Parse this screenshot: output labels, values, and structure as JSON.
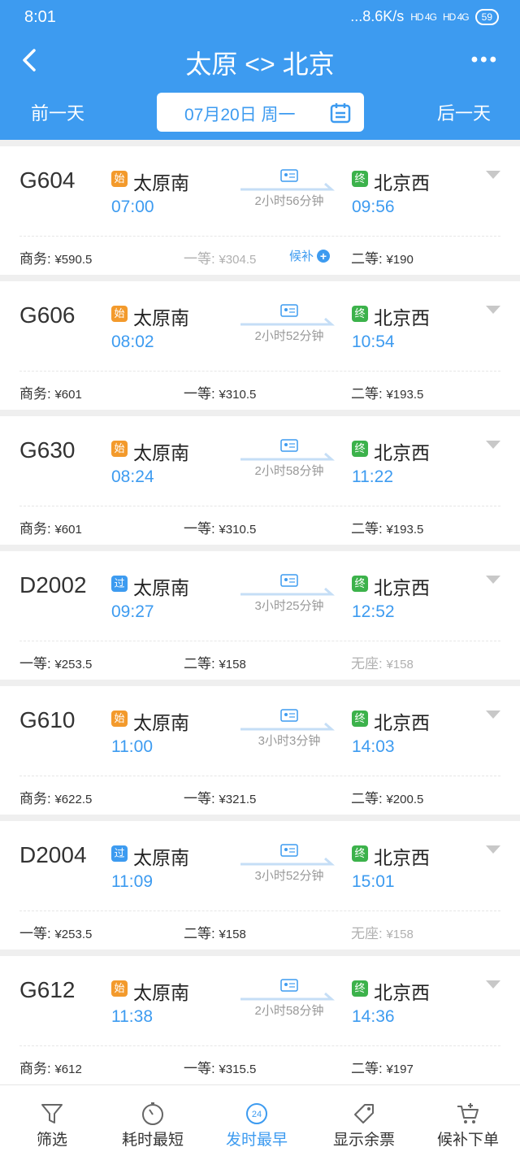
{
  "status_bar": {
    "time": "8:01",
    "net_speed": "...8.6K/s",
    "signal1": "HD 4G",
    "signal2": "HD 4G",
    "battery": "59"
  },
  "header": {
    "title": "太原 <> 北京",
    "prev_day": "前一天",
    "next_day": "后一天",
    "date": "07月20日 周一"
  },
  "trains": [
    {
      "no": "G604",
      "from_tag": "始",
      "from": "太原南",
      "dep": "07:00",
      "duration": "2小时56分钟",
      "to_tag": "终",
      "to": "北京西",
      "arr": "09:56",
      "p1_label": "商务:",
      "p1": "¥590.5",
      "p2_label": "一等:",
      "p2": "¥304.5",
      "houbu": "候补",
      "p3_label": "二等:",
      "p3": "¥190"
    },
    {
      "no": "G606",
      "from_tag": "始",
      "from": "太原南",
      "dep": "08:02",
      "duration": "2小时52分钟",
      "to_tag": "终",
      "to": "北京西",
      "arr": "10:54",
      "p1_label": "商务:",
      "p1": "¥601",
      "p2_label": "一等:",
      "p2": "¥310.5",
      "p3_label": "二等:",
      "p3": "¥193.5"
    },
    {
      "no": "G630",
      "from_tag": "始",
      "from": "太原南",
      "dep": "08:24",
      "duration": "2小时58分钟",
      "to_tag": "终",
      "to": "北京西",
      "arr": "11:22",
      "p1_label": "商务:",
      "p1": "¥601",
      "p2_label": "一等:",
      "p2": "¥310.5",
      "p3_label": "二等:",
      "p3": "¥193.5"
    },
    {
      "no": "D2002",
      "from_tag": "过",
      "from": "太原南",
      "dep": "09:27",
      "duration": "3小时25分钟",
      "to_tag": "终",
      "to": "北京西",
      "arr": "12:52",
      "p1_label": "一等:",
      "p1": "¥253.5",
      "p2_label": "二等:",
      "p2": "¥158",
      "p3_label": "无座:",
      "p3": "¥158"
    },
    {
      "no": "G610",
      "from_tag": "始",
      "from": "太原南",
      "dep": "11:00",
      "duration": "3小时3分钟",
      "to_tag": "终",
      "to": "北京西",
      "arr": "14:03",
      "p1_label": "商务:",
      "p1": "¥622.5",
      "p2_label": "一等:",
      "p2": "¥321.5",
      "p3_label": "二等:",
      "p3": "¥200.5"
    },
    {
      "no": "D2004",
      "from_tag": "过",
      "from": "太原南",
      "dep": "11:09",
      "duration": "3小时52分钟",
      "to_tag": "终",
      "to": "北京西",
      "arr": "15:01",
      "p1_label": "一等:",
      "p1": "¥253.5",
      "p2_label": "二等:",
      "p2": "¥158",
      "p3_label": "无座:",
      "p3": "¥158"
    },
    {
      "no": "G612",
      "from_tag": "始",
      "from": "太原南",
      "dep": "11:38",
      "duration": "2小时58分钟",
      "to_tag": "终",
      "to": "北京西",
      "arr": "14:36",
      "p1_label": "商务:",
      "p1": "¥612",
      "p2_label": "一等:",
      "p2": "¥315.5",
      "p3_label": "二等:",
      "p3": "¥197"
    }
  ],
  "tabbar": {
    "filter": "筛选",
    "shortest": "耗时最短",
    "earliest": "发时最早",
    "earliest_icon": "24",
    "show_tickets": "显示余票",
    "waitlist": "候补下单"
  },
  "icons": {
    "back": "back-arrow-icon",
    "more": "more-dots-icon",
    "calendar": "calendar-icon",
    "ticket": "ticket-id-icon",
    "chevron": "chevron-down-icon"
  },
  "colors": {
    "primary": "#3d9bf0",
    "start_badge": "#f39a2c",
    "end_badge": "#3cb24b"
  }
}
